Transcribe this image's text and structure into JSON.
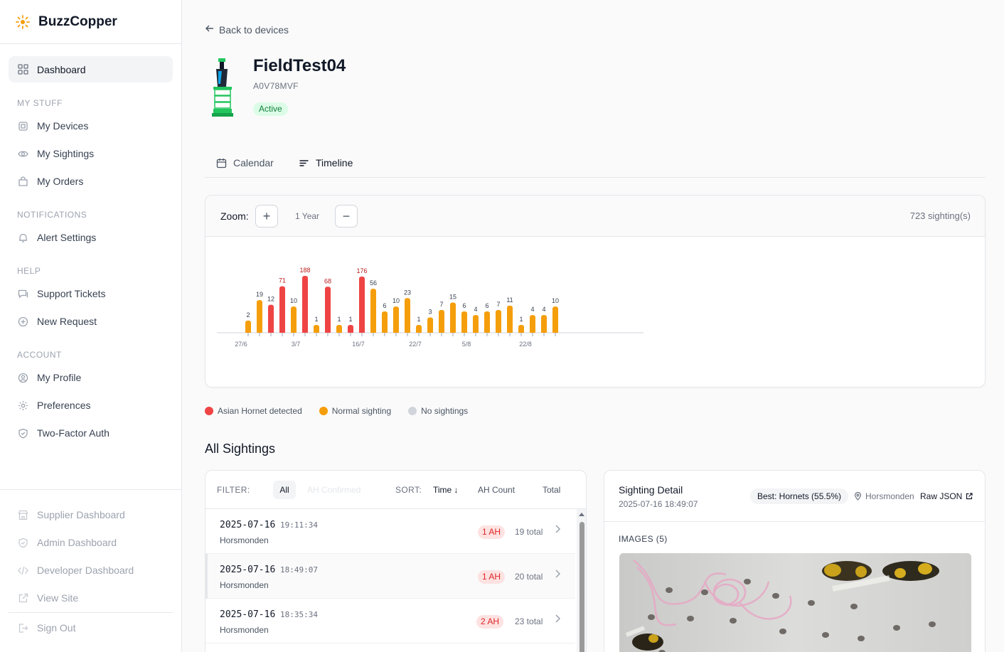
{
  "brand": {
    "name": "BuzzCopper"
  },
  "sidebar": {
    "active": {
      "label": "Dashboard",
      "icon": "grid-icon"
    },
    "sections": [
      {
        "title": "MY STUFF",
        "items": [
          {
            "label": "My Devices",
            "icon": "chip-icon"
          },
          {
            "label": "My Sightings",
            "icon": "eye-icon"
          },
          {
            "label": "My Orders",
            "icon": "bag-icon"
          }
        ]
      },
      {
        "title": "NOTIFICATIONS",
        "items": [
          {
            "label": "Alert Settings",
            "icon": "bell-icon"
          }
        ]
      },
      {
        "title": "HELP",
        "items": [
          {
            "label": "Support Tickets",
            "icon": "chat-icon"
          },
          {
            "label": "New Request",
            "icon": "plus-circle-icon"
          }
        ]
      },
      {
        "title": "ACCOUNT",
        "items": [
          {
            "label": "My Profile",
            "icon": "user-circle-icon"
          },
          {
            "label": "Preferences",
            "icon": "gear-icon"
          },
          {
            "label": "Two-Factor Auth",
            "icon": "shield-icon"
          }
        ]
      }
    ],
    "footer": [
      {
        "label": "Supplier Dashboard",
        "icon": "store-icon"
      },
      {
        "label": "Admin Dashboard",
        "icon": "shield-icon"
      },
      {
        "label": "Developer Dashboard",
        "icon": "code-icon"
      },
      {
        "label": "View Site",
        "icon": "external-icon"
      },
      {
        "label": "Sign Out",
        "icon": "logout-icon"
      }
    ]
  },
  "back": {
    "label": "Back to devices"
  },
  "device": {
    "name": "FieldTest04",
    "id": "A0V78MVF",
    "status": "Active"
  },
  "tabs": {
    "calendar": "Calendar",
    "timeline": "Timeline"
  },
  "timeline": {
    "zoom_label": "Zoom:",
    "zoom_in": "+",
    "zoom_out": "−",
    "zoom_level": "1 Year",
    "sighting_count": "723 sighting(s)"
  },
  "chart_data": {
    "type": "bar",
    "bars": [
      {
        "value": 2,
        "ah": false
      },
      {
        "value": 19,
        "ah": false
      },
      {
        "value": 12,
        "ah": true
      },
      {
        "value": 71,
        "ah": true
      },
      {
        "value": 10,
        "ah": false
      },
      {
        "value": 188,
        "ah": true
      },
      {
        "value": 1,
        "ah": false
      },
      {
        "value": 68,
        "ah": true
      },
      {
        "value": 1,
        "ah": false
      },
      {
        "value": 1,
        "ah": true
      },
      {
        "value": 176,
        "ah": true
      },
      {
        "value": 56,
        "ah": false
      },
      {
        "value": 6,
        "ah": false
      },
      {
        "value": 10,
        "ah": false
      },
      {
        "value": 23,
        "ah": false
      },
      {
        "value": 1,
        "ah": false
      },
      {
        "value": 3,
        "ah": false
      },
      {
        "value": 7,
        "ah": false
      },
      {
        "value": 15,
        "ah": false
      },
      {
        "value": 6,
        "ah": false
      },
      {
        "value": 4,
        "ah": false
      },
      {
        "value": 6,
        "ah": false
      },
      {
        "value": 7,
        "ah": false
      },
      {
        "value": 11,
        "ah": false
      },
      {
        "value": 1,
        "ah": false
      },
      {
        "value": 4,
        "ah": false
      },
      {
        "value": 4,
        "ah": false
      },
      {
        "value": 10,
        "ah": false
      }
    ],
    "x_tick_labels": [
      "27/6",
      "3/7",
      "16/7",
      "22/7",
      "5/8",
      "22/8"
    ],
    "colors": {
      "ah": "#ef4444",
      "normal": "#f59e0b",
      "none": "#d1d5db"
    }
  },
  "legend": [
    {
      "label": "Asian Hornet detected",
      "color": "#ef4444"
    },
    {
      "label": "Normal sighting",
      "color": "#f59e0b"
    },
    {
      "label": "No sightings",
      "color": "#d1d5db"
    }
  ],
  "sightings": {
    "title": "All Sightings",
    "filter_label": "FILTER:",
    "filter_all": "All",
    "filter_ah": "AH Confirmed",
    "sort_label": "SORT:",
    "sort_time": "Time ↓",
    "sort_ah": "AH Count",
    "sort_total": "Total",
    "rows": [
      {
        "date": "2025-07-16",
        "time": "19:11:34",
        "location": "Horsmonden",
        "ah": "1 AH",
        "total": "19 total"
      },
      {
        "date": "2025-07-16",
        "time": "18:49:07",
        "location": "Horsmonden",
        "ah": "1 AH",
        "total": "20 total"
      },
      {
        "date": "2025-07-16",
        "time": "18:35:34",
        "location": "Horsmonden",
        "ah": "2 AH",
        "total": "23 total"
      }
    ]
  },
  "detail": {
    "title": "Sighting Detail",
    "timestamp": "2025-07-16 18:49:07",
    "best": "Best: Hornets (55.5%)",
    "location": "Horsmonden",
    "raw": "Raw JSON",
    "images_label": "IMAGES (5)"
  }
}
